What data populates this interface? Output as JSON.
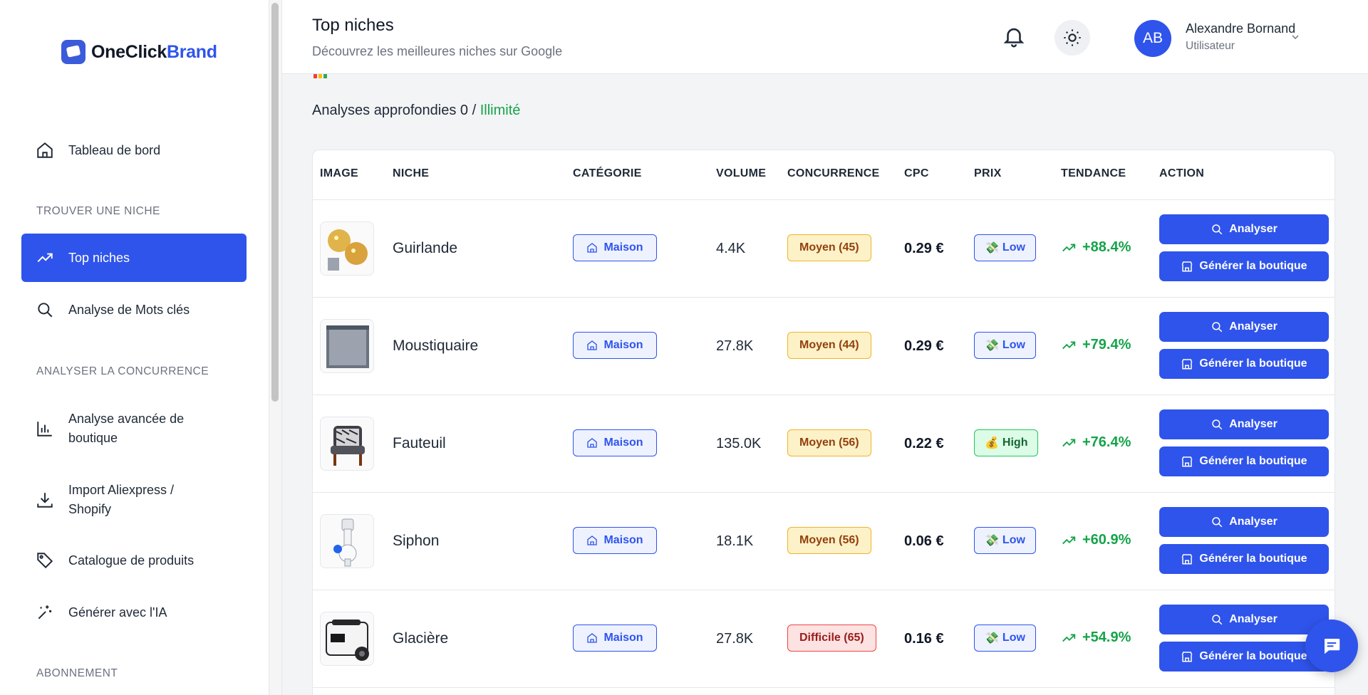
{
  "brand": {
    "name_a": "OneClick",
    "name_b": "Brand"
  },
  "sidebar": {
    "dashboard": "Tableau de bord",
    "section_find": "TROUVER UNE NICHE",
    "top_niches": "Top niches",
    "keywords": "Analyse de Mots clés",
    "section_compete": "ANALYSER LA CONCURRENCE",
    "store_analysis": "Analyse avancée de boutique",
    "import": "Import Aliexpress / Shopify",
    "catalog": "Catalogue de produits",
    "ai": "Générer avec l'IA",
    "section_sub": "ABONNEMENT"
  },
  "header": {
    "title": "Top niches",
    "subtitle": "Découvrez les meilleures niches sur Google",
    "user_initials": "AB",
    "user_name": "Alexandre Bornand",
    "user_role": "Utilisateur"
  },
  "main": {
    "analyses_prefix": "Analyses approfondies 0 / ",
    "analyses_limit": "Illimité"
  },
  "table": {
    "headers": {
      "image": "IMAGE",
      "niche": "NICHE",
      "category": "CATÉGORIE",
      "volume": "VOLUME",
      "competition": "CONCURRENCE",
      "cpc": "CPC",
      "price": "PRIX",
      "trend": "TENDANCE",
      "action": "ACTION"
    },
    "buttons": {
      "analyze": "Analyser",
      "generate": "Générer la boutique"
    },
    "rows": [
      {
        "niche": "Guirlande",
        "category": "Maison",
        "volume": "4.4K",
        "competition": "Moyen (45)",
        "cpc": "0.29 €",
        "price": "Low",
        "price_icon": "💸",
        "trend": "+88.4%"
      },
      {
        "niche": "Moustiquaire",
        "category": "Maison",
        "volume": "27.8K",
        "competition": "Moyen (44)",
        "cpc": "0.29 €",
        "price": "Low",
        "price_icon": "💸",
        "trend": "+79.4%"
      },
      {
        "niche": "Fauteuil",
        "category": "Maison",
        "volume": "135.0K",
        "competition": "Moyen (56)",
        "cpc": "0.22 €",
        "price": "High",
        "price_icon": "💰",
        "trend": "+76.4%"
      },
      {
        "niche": "Siphon",
        "category": "Maison",
        "volume": "18.1K",
        "competition": "Moyen (56)",
        "cpc": "0.06 €",
        "price": "Low",
        "price_icon": "💸",
        "trend": "+60.9%"
      },
      {
        "niche": "Glacière",
        "category": "Maison",
        "volume": "27.8K",
        "competition": "Difficile (65)",
        "cpc": "0.16 €",
        "price": "Low",
        "price_icon": "💸",
        "trend": "+54.9%"
      }
    ]
  },
  "colors": {
    "accent": "#2f54eb",
    "success": "#16a34a",
    "warning": "#f0b429",
    "danger": "#ef4444"
  }
}
